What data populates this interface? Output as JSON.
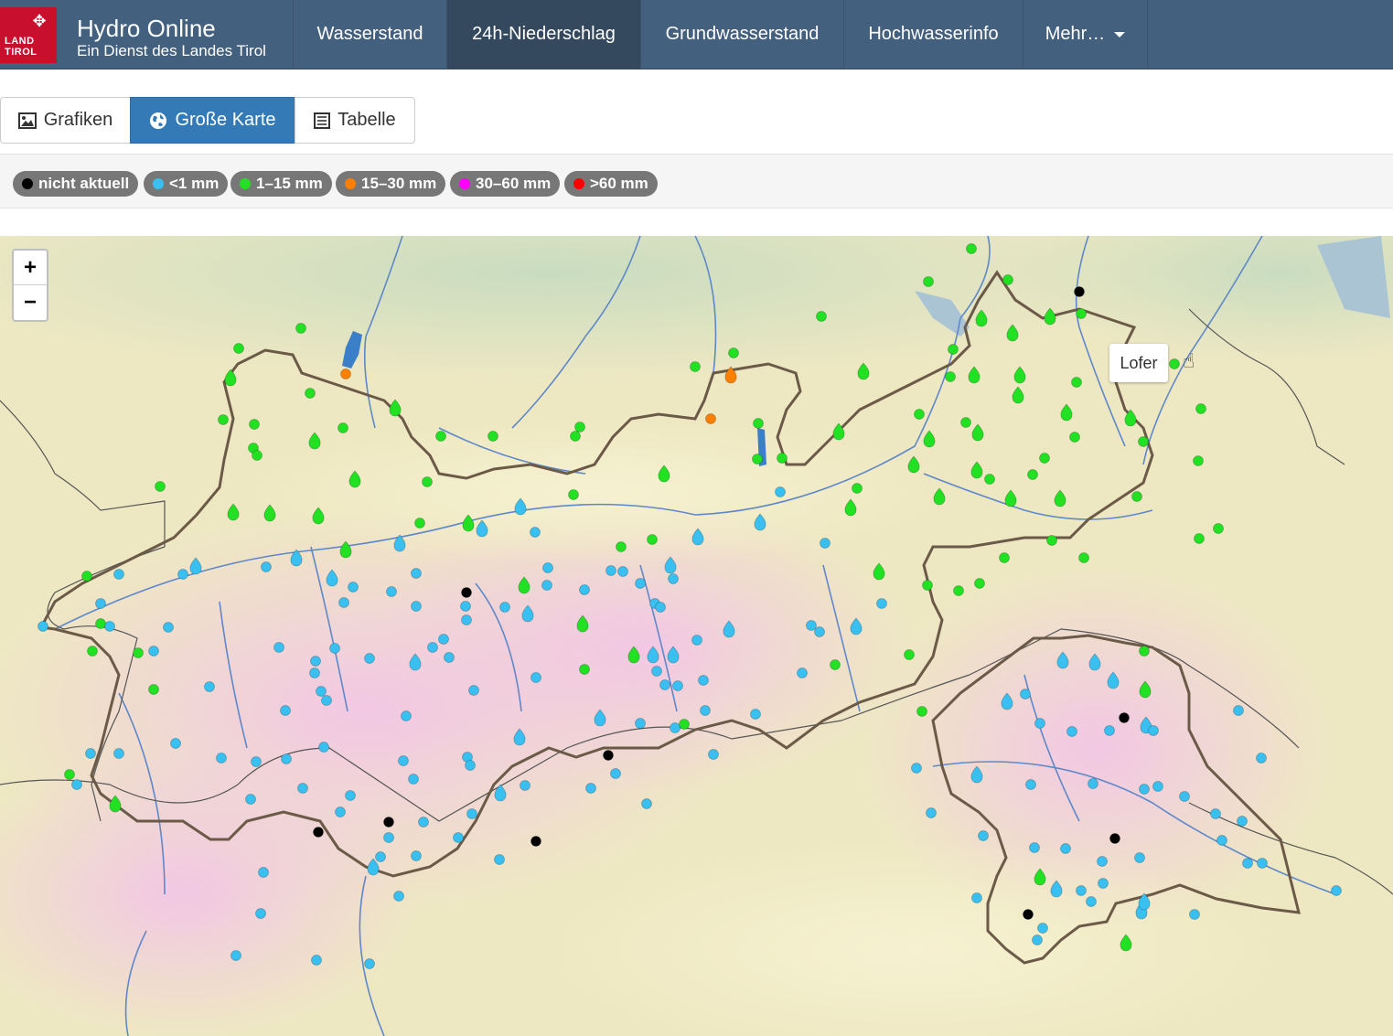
{
  "brand": {
    "logo_line1": "LAND",
    "logo_line2": "TIROL",
    "title": "Hydro Online",
    "subtitle": "Ein Dienst des Landes Tirol"
  },
  "nav": {
    "items": [
      {
        "label": "Wasserstand"
      },
      {
        "label": "24h-Niederschlag"
      },
      {
        "label": "Grundwasserstand"
      },
      {
        "label": "Hochwasserinfo"
      },
      {
        "label": "Mehr…"
      }
    ],
    "active": "24h-Niederschlag"
  },
  "views": {
    "grafiken": "Grafiken",
    "karte": "Große Karte",
    "tabelle": "Tabelle",
    "active": "Große Karte"
  },
  "legend": {
    "items": [
      {
        "label": "nicht aktuell",
        "color": "#000000"
      },
      {
        "label": "<1 mm",
        "color": "#39c0f0"
      },
      {
        "label": "1–15 mm",
        "color": "#22e022"
      },
      {
        "label": "15–30 mm",
        "color": "#ff8000"
      },
      {
        "label": "30–60 mm",
        "color": "#ff00ff"
      },
      {
        "label": ">60 mm",
        "color": "#ff0000"
      }
    ]
  },
  "map": {
    "zoom_in": "+",
    "zoom_out": "−",
    "hover_station": "Lofer"
  }
}
